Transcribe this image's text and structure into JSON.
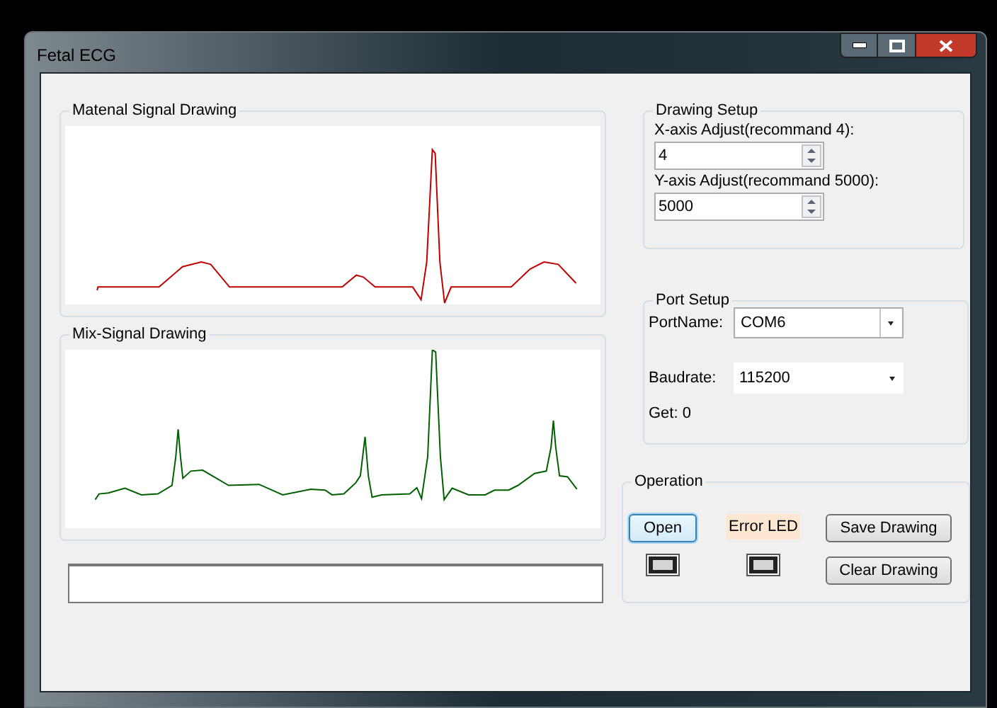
{
  "window": {
    "title": "Fetal ECG"
  },
  "maternal_panel": {
    "title": "Matenal Signal Drawing"
  },
  "mix_panel": {
    "title": "Mix-Signal Drawing"
  },
  "drawing_setup": {
    "title": "Drawing Setup",
    "fields": [
      {
        "label": "X-axis Adjust(recommand 4):",
        "value": "4"
      },
      {
        "label": "Y-axis Adjust(recommand 5000):",
        "value": "5000"
      }
    ]
  },
  "port_setup": {
    "title": "Port Setup",
    "port_label": "PortName:",
    "port_value": "COM6",
    "baud_label": "Baudrate:",
    "baud_value": "115200",
    "get_text": "Get: 0"
  },
  "operation": {
    "title": "Operation",
    "open_button": {
      "label": "Open",
      "focused": true
    },
    "error_label": "Error LED",
    "buttons": [
      "Save Drawing",
      "Clear Drawing"
    ]
  }
}
